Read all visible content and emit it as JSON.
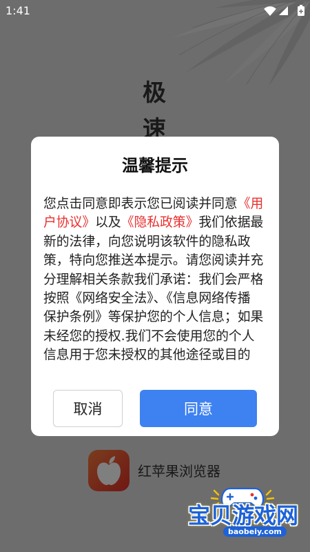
{
  "status_bar": {
    "time": "1:41",
    "icons": {
      "wifi": "wifi-icon",
      "signal": "signal-icon",
      "battery": "battery-icon"
    }
  },
  "splash": {
    "vertical_title": [
      "极",
      "速"
    ],
    "app_icon": "red-apple-icon",
    "app_name": "红苹果浏览器"
  },
  "dialog": {
    "title": "温馨提示",
    "body_lines": [
      [
        {
          "text": "您点击同意即表示您已阅读并同意",
          "is_link": false
        },
        {
          "text": "《用",
          "is_link": true
        }
      ],
      [
        {
          "text": "户协议》",
          "is_link": true
        },
        {
          "text": "以及",
          "is_link": false
        },
        {
          "text": "《隐私政策》",
          "is_link": true
        },
        {
          "text": "我们依据最",
          "is_link": false
        }
      ],
      [
        {
          "text": "新的法律，向您说明该软件的隐私政",
          "is_link": false
        }
      ],
      [
        {
          "text": "策，特向您推送本提示。请您阅读并充",
          "is_link": false
        }
      ],
      [
        {
          "text": "分理解相关条款我们承诺：我们会严格",
          "is_link": false
        }
      ],
      [
        {
          "text": "按照《网络安全法》、《信息网络传播",
          "is_link": false
        }
      ],
      [
        {
          "text": "保护条例》等保护您的个人信息；如果",
          "is_link": false
        }
      ],
      [
        {
          "text": "未经您的授权.我们不会使用您的个人",
          "is_link": false
        }
      ],
      [
        {
          "text": "信息用于您未授权的其他途径或目的",
          "is_link": false
        }
      ]
    ],
    "cancel_label": "取消",
    "agree_label": "同意"
  },
  "watermark": {
    "icon": "gamepad-icon",
    "name": "宝贝游戏网",
    "domain": "baobeiy.com"
  },
  "colors": {
    "accent": "#3e81f0",
    "link": "#e8302e",
    "scrim": "rgba(0,0,0,0.5)",
    "watermark_blue": "#1d62d8"
  }
}
